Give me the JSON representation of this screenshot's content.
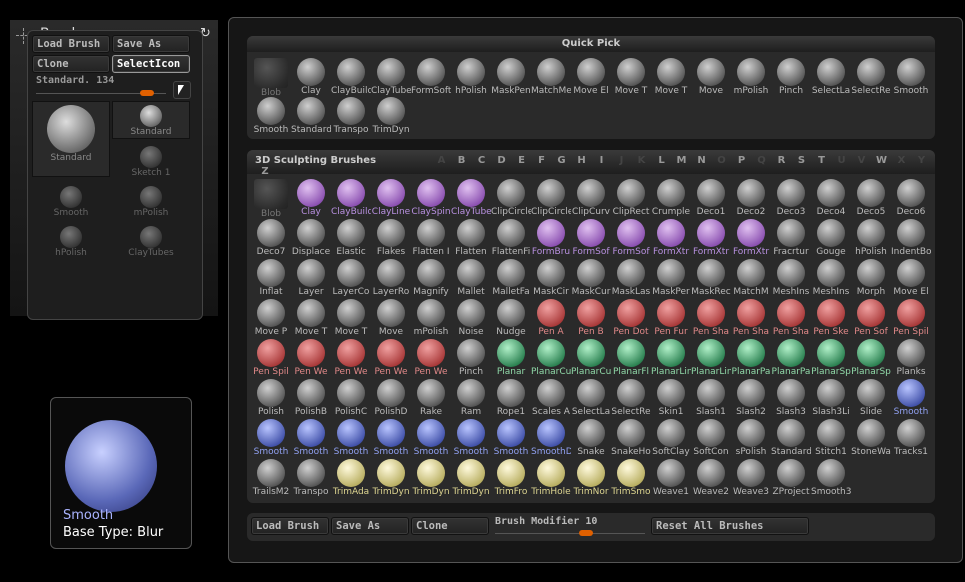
{
  "left_panel": {
    "title": "Brush",
    "load_brush": "Load Brush",
    "save_as": "Save As",
    "clone": "Clone",
    "select_icon": "SelectIcon",
    "current_brush": "Standard. 134",
    "slider_value": 0.75,
    "thumbs": [
      "Standard",
      "Standard",
      "Sketch 1",
      "Smooth",
      "mPolish",
      "hPolish",
      "ClayTubes"
    ]
  },
  "preview": {
    "name": "Smooth",
    "base_type": "Base Type: Blur"
  },
  "quick_pick": {
    "title": "Quick Pick",
    "items": [
      [
        "Blob",
        "dim"
      ],
      [
        "Clay",
        "grey"
      ],
      [
        "ClayBuild",
        "grey"
      ],
      [
        "ClayTube",
        "grey"
      ],
      [
        "FormSoft",
        "grey"
      ],
      [
        "hPolish",
        "grey"
      ],
      [
        "MaskPen",
        "grey"
      ],
      [
        "MatchMe",
        "grey"
      ],
      [
        "Move El",
        "grey"
      ],
      [
        "Move T",
        "grey"
      ],
      [
        "Move T",
        "grey"
      ],
      [
        "Move",
        "grey"
      ],
      [
        "mPolish",
        "grey"
      ],
      [
        "Pinch",
        "grey"
      ],
      [
        "SelectLa",
        "grey"
      ],
      [
        "SelectRe",
        "grey"
      ],
      [
        "Smooth",
        "grey"
      ],
      [
        "Smooth",
        "grey"
      ],
      [
        "Standard",
        "grey"
      ],
      [
        "Transpo",
        "grey"
      ],
      [
        "TrimDyn",
        "grey"
      ]
    ]
  },
  "sculpt": {
    "title": "3D Sculpting Brushes",
    "letters": [
      [
        "A",
        0
      ],
      [
        "B",
        1
      ],
      [
        "C",
        1
      ],
      [
        "D",
        1
      ],
      [
        "E",
        1
      ],
      [
        "F",
        1
      ],
      [
        "G",
        1
      ],
      [
        "H",
        1
      ],
      [
        "I",
        1
      ],
      [
        "J",
        0
      ],
      [
        "K",
        0
      ],
      [
        "L",
        1
      ],
      [
        "M",
        1
      ],
      [
        "N",
        1
      ],
      [
        "O",
        0
      ],
      [
        "P",
        1
      ],
      [
        "Q",
        0
      ],
      [
        "R",
        1
      ],
      [
        "S",
        1
      ],
      [
        "T",
        1
      ],
      [
        "U",
        0
      ],
      [
        "V",
        0
      ],
      [
        "W",
        1
      ],
      [
        "X",
        0
      ],
      [
        "Y",
        0
      ],
      [
        "Z",
        1
      ]
    ],
    "items": [
      [
        "Blob",
        "dim"
      ],
      [
        "Clay",
        "purple"
      ],
      [
        "ClayBuild",
        "purple"
      ],
      [
        "ClayLine",
        "purple"
      ],
      [
        "ClaySpin",
        "purple"
      ],
      [
        "ClayTube",
        "purple"
      ],
      [
        "ClipCircle",
        "grey"
      ],
      [
        "ClipCircle",
        "grey"
      ],
      [
        "ClipCurv",
        "grey"
      ],
      [
        "ClipRect",
        "grey"
      ],
      [
        "Crumple",
        "grey"
      ],
      [
        "Deco1",
        "grey"
      ],
      [
        "Deco2",
        "grey"
      ],
      [
        "Deco3",
        "grey"
      ],
      [
        "Deco4",
        "grey"
      ],
      [
        "Deco5",
        "grey"
      ],
      [
        "Deco6",
        "grey"
      ],
      [
        "Deco7",
        "grey"
      ],
      [
        "Displace",
        "grey"
      ],
      [
        "Elastic",
        "grey"
      ],
      [
        "Flakes",
        "grey"
      ],
      [
        "Flatten I",
        "grey"
      ],
      [
        "Flatten",
        "grey"
      ],
      [
        "FlattenFi",
        "grey"
      ],
      [
        "FormBru",
        "purple"
      ],
      [
        "FormSof",
        "purple"
      ],
      [
        "FormSof",
        "purple"
      ],
      [
        "FormXtr",
        "purple"
      ],
      [
        "FormXtr",
        "purple"
      ],
      [
        "FormXtr",
        "purple"
      ],
      [
        "Fracrtur",
        "grey"
      ],
      [
        "Gouge",
        "grey"
      ],
      [
        "hPolish",
        "grey"
      ],
      [
        "IndentBo",
        "grey"
      ],
      [
        "Inflat",
        "grey"
      ],
      [
        "Layer",
        "grey"
      ],
      [
        "LayerCo",
        "grey"
      ],
      [
        "LayerRo",
        "grey"
      ],
      [
        "Magnify",
        "grey"
      ],
      [
        "Mallet",
        "grey"
      ],
      [
        "MalletFa",
        "grey"
      ],
      [
        "MaskCir",
        "grey"
      ],
      [
        "MaskCur",
        "grey"
      ],
      [
        "MaskLas",
        "grey"
      ],
      [
        "MaskPer",
        "grey"
      ],
      [
        "MaskRec",
        "grey"
      ],
      [
        "MatchM",
        "grey"
      ],
      [
        "MeshIns",
        "grey"
      ],
      [
        "MeshIns",
        "grey"
      ],
      [
        "Morph",
        "grey"
      ],
      [
        "Move El",
        "grey"
      ],
      [
        "Move P",
        "grey"
      ],
      [
        "Move T",
        "grey"
      ],
      [
        "Move T",
        "grey"
      ],
      [
        "Move",
        "grey"
      ],
      [
        "mPolish",
        "grey"
      ],
      [
        "Noise",
        "grey"
      ],
      [
        "Nudge",
        "grey"
      ],
      [
        "Pen A",
        "red"
      ],
      [
        "Pen B",
        "red"
      ],
      [
        "Pen Dot",
        "red"
      ],
      [
        "Pen Fur",
        "red"
      ],
      [
        "Pen Sha",
        "red"
      ],
      [
        "Pen Sha",
        "red"
      ],
      [
        "Pen Sha",
        "red"
      ],
      [
        "Pen Ske",
        "red"
      ],
      [
        "Pen Sof",
        "red"
      ],
      [
        "Pen Spil",
        "red"
      ],
      [
        "Pen Spil",
        "red"
      ],
      [
        "Pen We",
        "red"
      ],
      [
        "Pen We",
        "red"
      ],
      [
        "Pen We",
        "red"
      ],
      [
        "Pen We",
        "red"
      ],
      [
        "Pinch",
        "grey"
      ],
      [
        "Planar",
        "green"
      ],
      [
        "PlanarCu",
        "green"
      ],
      [
        "PlanarCu",
        "green"
      ],
      [
        "PlanarFl",
        "green"
      ],
      [
        "PlanarLin",
        "green"
      ],
      [
        "PlanarLin",
        "green"
      ],
      [
        "PlanarPa",
        "green"
      ],
      [
        "PlanarPa",
        "green"
      ],
      [
        "PlanarSp",
        "green"
      ],
      [
        "PlanarSp",
        "green"
      ],
      [
        "Planks",
        "grey"
      ],
      [
        "Polish",
        "grey"
      ],
      [
        "PolishB",
        "grey"
      ],
      [
        "PolishC",
        "grey"
      ],
      [
        "PolishD",
        "grey"
      ],
      [
        "Rake",
        "grey"
      ],
      [
        "Ram",
        "grey"
      ],
      [
        "Rope1",
        "grey"
      ],
      [
        "Scales A",
        "grey"
      ],
      [
        "SelectLa",
        "grey"
      ],
      [
        "SelectRe",
        "grey"
      ],
      [
        "Skin1",
        "grey"
      ],
      [
        "Slash1",
        "grey"
      ],
      [
        "Slash2",
        "grey"
      ],
      [
        "Slash3",
        "grey"
      ],
      [
        "Slash3Li",
        "grey"
      ],
      [
        "Slide",
        "grey"
      ],
      [
        "Smooth",
        "blue"
      ],
      [
        "Smooth",
        "blue"
      ],
      [
        "Smooth",
        "blue"
      ],
      [
        "Smooth",
        "blue"
      ],
      [
        "Smooth",
        "blue"
      ],
      [
        "Smooth",
        "blue"
      ],
      [
        "Smooth",
        "blue"
      ],
      [
        "Smooth",
        "blue"
      ],
      [
        "SmoothD",
        "blue"
      ],
      [
        "Snake",
        "grey"
      ],
      [
        "SnakeHo",
        "grey"
      ],
      [
        "SoftClay",
        "grey"
      ],
      [
        "SoftCon",
        "grey"
      ],
      [
        "sPolish",
        "grey"
      ],
      [
        "Standard",
        "grey"
      ],
      [
        "Stitch1",
        "grey"
      ],
      [
        "StoneWa",
        "grey"
      ],
      [
        "Tracks1",
        "grey"
      ],
      [
        "TrailsM2",
        "grey"
      ],
      [
        "Transpo",
        "grey"
      ],
      [
        "TrimAda",
        "yellow"
      ],
      [
        "TrimDyn",
        "yellow"
      ],
      [
        "TrimDyn",
        "yellow"
      ],
      [
        "TrimDyn",
        "yellow"
      ],
      [
        "TrimFro",
        "yellow"
      ],
      [
        "TrimHole",
        "yellow"
      ],
      [
        "TrimNor",
        "yellow"
      ],
      [
        "TrimSmo",
        "yellow"
      ],
      [
        "Weave1",
        "grey"
      ],
      [
        "Weave2",
        "grey"
      ],
      [
        "Weave3",
        "grey"
      ],
      [
        "ZProject",
        "grey"
      ],
      [
        "Smooth3",
        "grey"
      ]
    ]
  },
  "bottom": {
    "load_brush": "Load Brush",
    "save_as": "Save As",
    "clone": "Clone",
    "modifier_label": "Brush Modifier",
    "modifier_value": "10",
    "reset_all": "Reset All Brushes"
  },
  "colors": {
    "grey": [
      "#cfcfcf",
      "#555",
      "#bbb"
    ],
    "dim": [
      "#555",
      "#2a2a2a",
      "#777"
    ],
    "purple": [
      "#e0c0f0",
      "#8a4fb0",
      "#b890e0"
    ],
    "red": [
      "#f0a0a0",
      "#a83838",
      "#e08888"
    ],
    "green": [
      "#b0f0c8",
      "#2a8050",
      "#90d8a8"
    ],
    "blue": [
      "#b8c4ff",
      "#4050a8",
      "#90a0f0"
    ],
    "yellow": [
      "#fffadc",
      "#b8ae60",
      "#dcd490"
    ],
    "accent": "#e06000"
  }
}
